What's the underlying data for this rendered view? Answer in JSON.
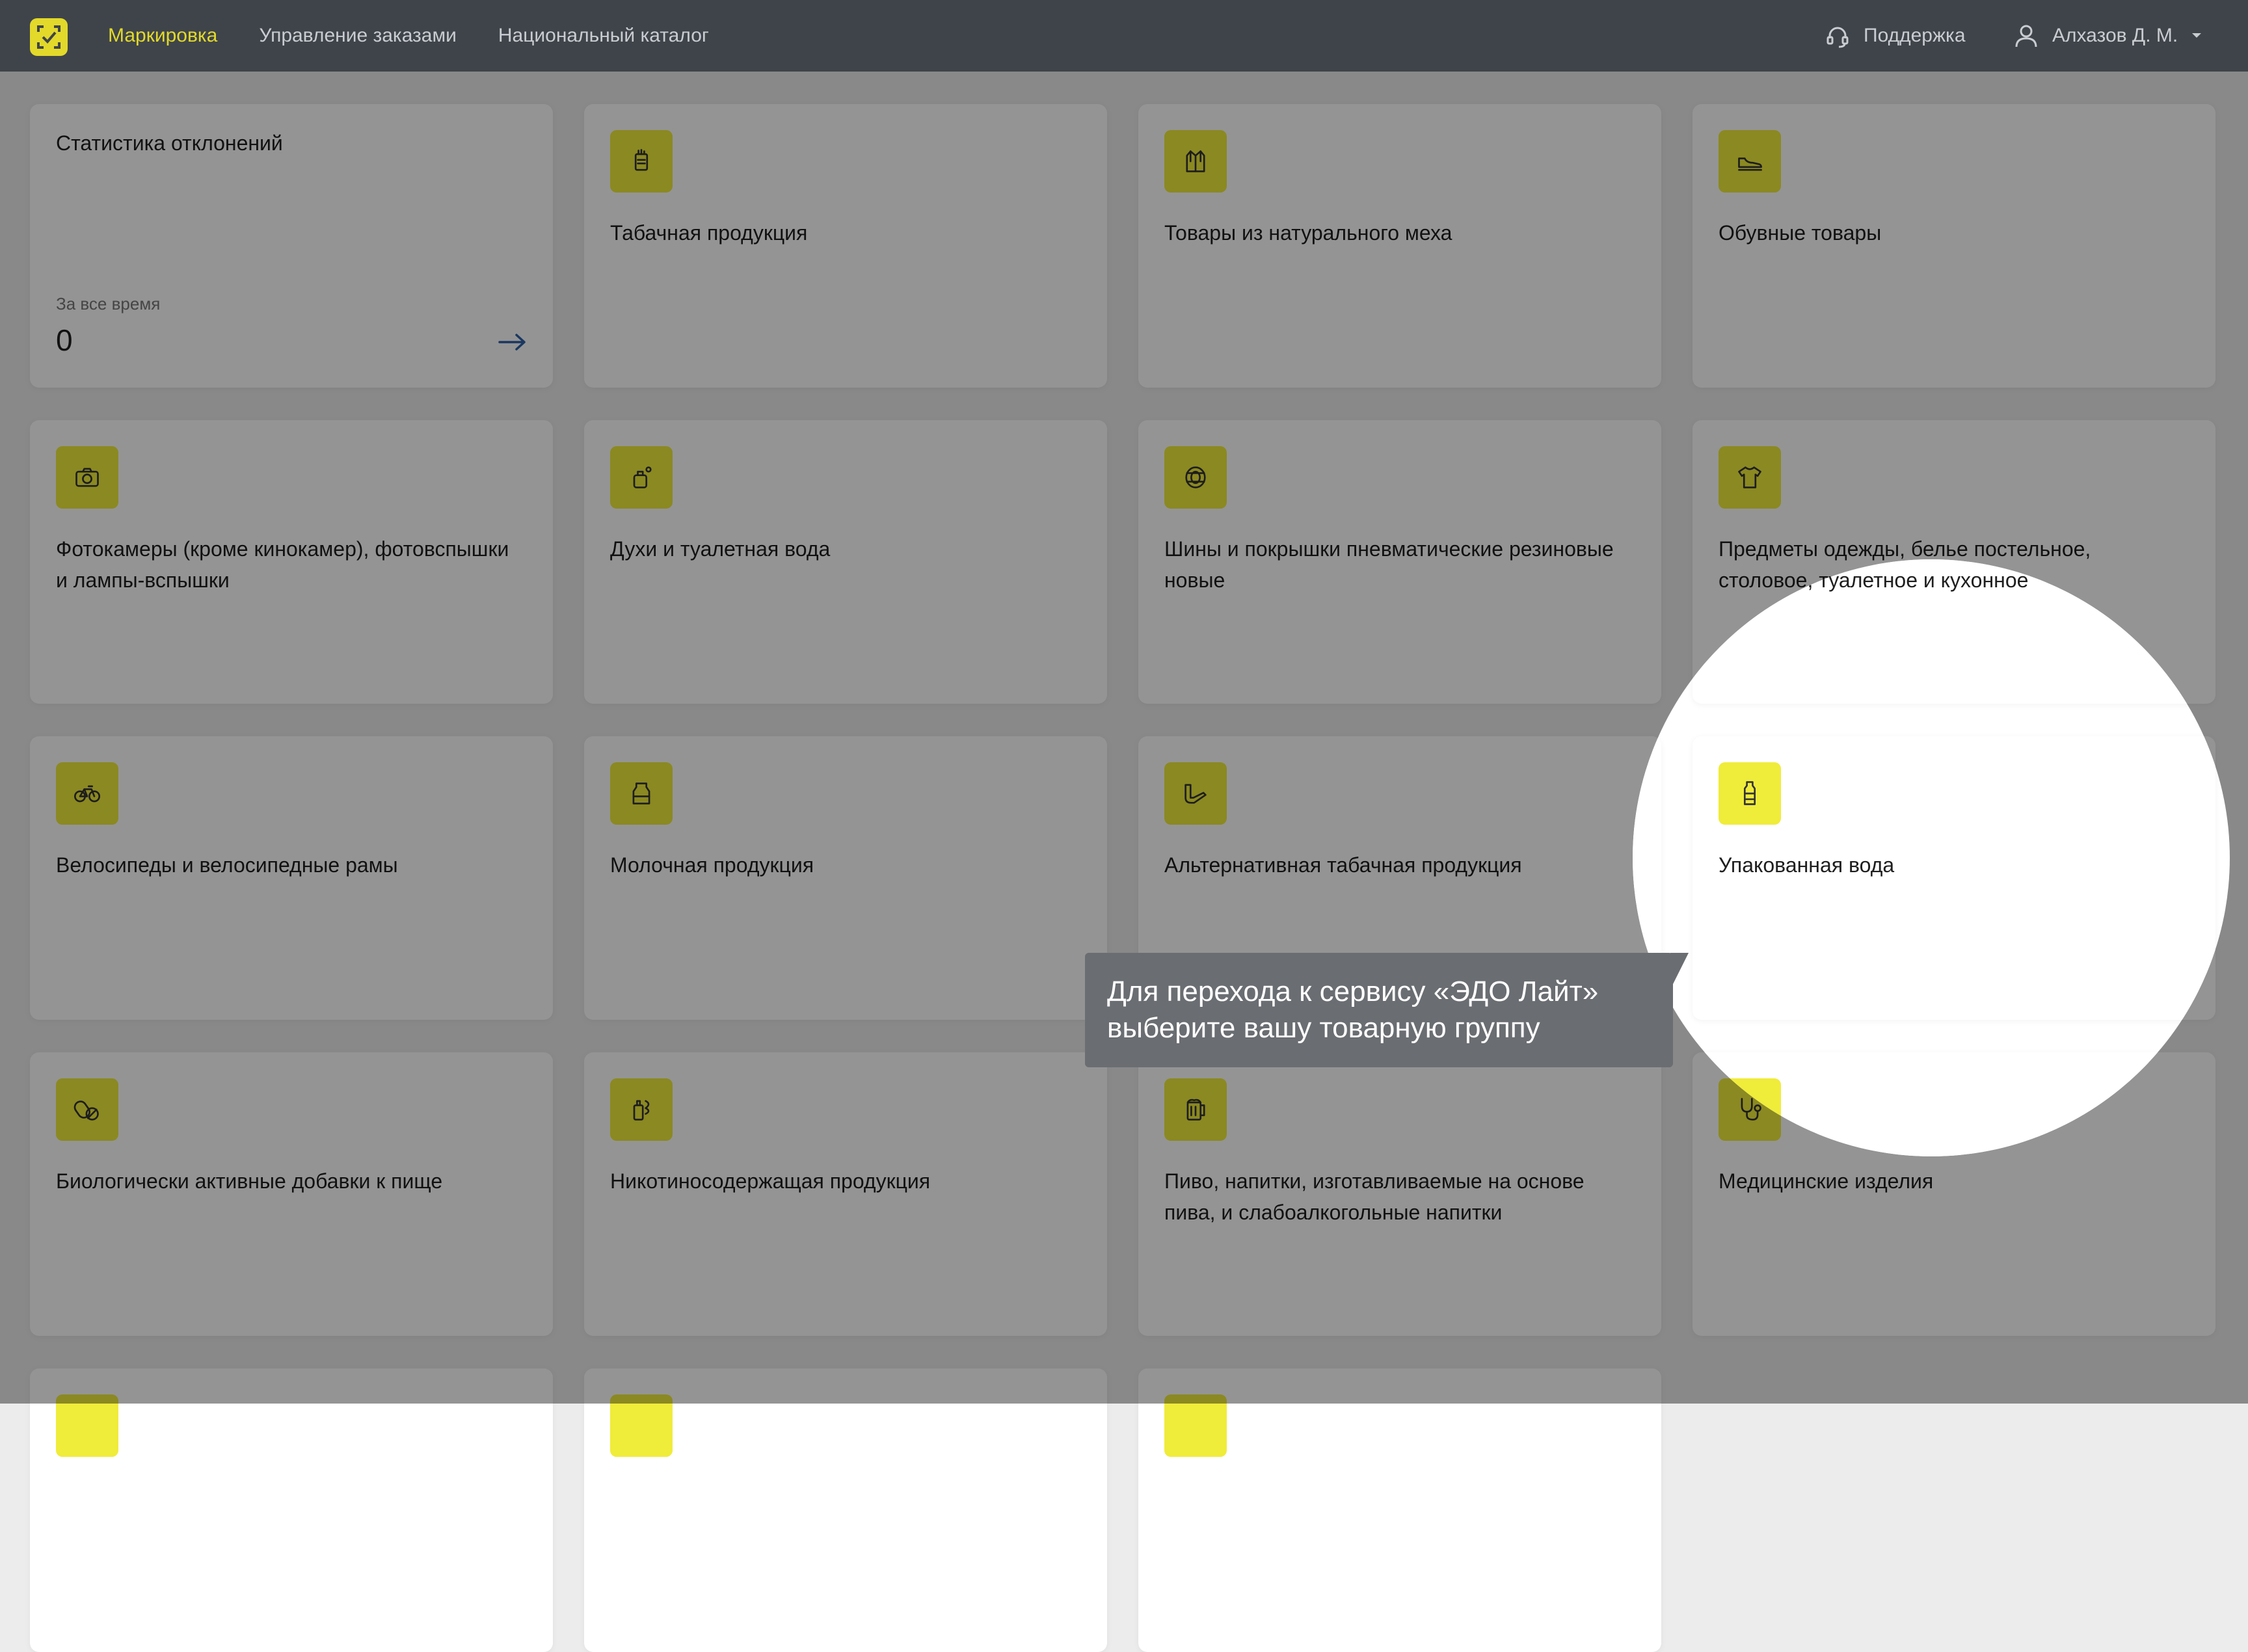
{
  "topbar": {
    "nav": [
      "Маркировка",
      "Управление заказами",
      "Национальный каталог"
    ],
    "support_label": "Поддержка",
    "user_name": "Алхазов Д. М."
  },
  "stats_card": {
    "title": "Статистика отклонений",
    "period_label": "За все время",
    "value": "0"
  },
  "categories": [
    {
      "label": "Табачная продукция",
      "icon": "cigarette-pack-icon"
    },
    {
      "label": "Товары из натурального меха",
      "icon": "fur-coat-icon"
    },
    {
      "label": "Обувные товары",
      "icon": "shoe-icon"
    },
    {
      "label": "Фотокамеры (кроме кинокамер), фотовспышки и лампы-вспышки",
      "icon": "camera-icon"
    },
    {
      "label": "Духи и туалетная вода",
      "icon": "perfume-icon"
    },
    {
      "label": "Шины и покрышки пневматические резиновые новые",
      "icon": "tire-icon"
    },
    {
      "label": "Предметы одежды, белье постельное, столовое, туалетное и кухонное",
      "icon": "tshirt-icon"
    },
    {
      "label": "Велосипеды и велосипедные рамы",
      "icon": "bicycle-icon"
    },
    {
      "label": "Молочная продукция",
      "icon": "milk-icon"
    },
    {
      "label": "Альтернативная табачная продукция",
      "icon": "pipe-icon"
    },
    {
      "label": "Упакованная вода",
      "icon": "water-bottle-icon"
    },
    {
      "label": "Биологически активные добавки к пище",
      "icon": "pills-icon"
    },
    {
      "label": "Никотиносодержащая продукция",
      "icon": "vape-icon"
    },
    {
      "label": "Пиво, напитки, изготавливаемые на основе пива, и слабоалкогольные напитки",
      "icon": "beer-mug-icon"
    },
    {
      "label": "Медицинские изделия",
      "icon": "stethoscope-icon"
    }
  ],
  "tooltip": {
    "text_line1": "Для перехода к сервису «ЭДО Лайт»",
    "text_line2": "выберите вашу товарную группу"
  },
  "colors": {
    "accent": "#e2d92a",
    "icon_bg": "#f0ec3a",
    "topbar_bg": "#3f444a"
  }
}
